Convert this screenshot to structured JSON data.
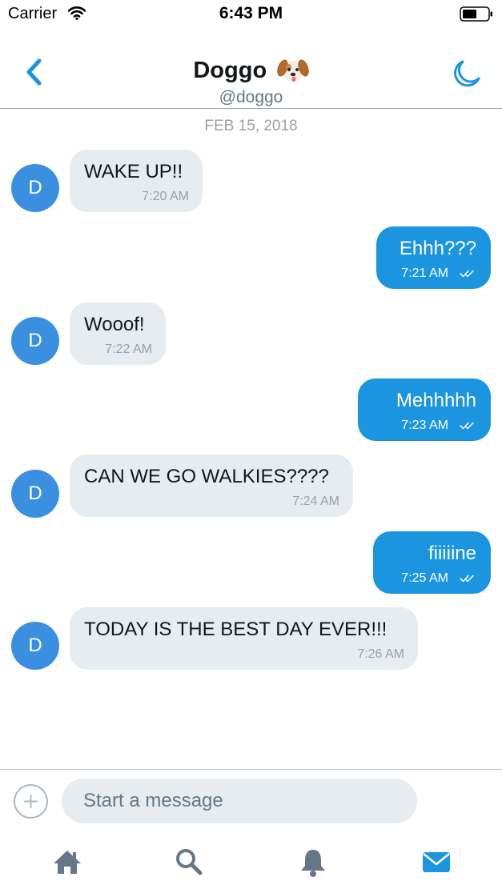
{
  "status_bar": {
    "carrier": "Carrier",
    "time": "6:43 PM",
    "icons": [
      "wifi-icon",
      "battery-icon"
    ]
  },
  "header": {
    "title": "Doggo",
    "title_emoji": "dog-face-icon",
    "handle": "@doggo",
    "icons": [
      "back-arrow-icon",
      "moon-icon"
    ],
    "accent_color": "#1b95e0"
  },
  "conversation": {
    "date": "FEB 15, 2018",
    "messages": [
      {
        "direction": "incoming",
        "avatar_letter": "D",
        "text": "WAKE UP!!",
        "time": "7:20 AM"
      },
      {
        "direction": "outgoing",
        "text": "Ehhh???",
        "time": "7:21 AM",
        "status_icon": "double-check-icon"
      },
      {
        "direction": "incoming",
        "avatar_letter": "D",
        "text": "Wooof!",
        "time": "7:22 AM"
      },
      {
        "direction": "outgoing",
        "text": "Mehhhhh",
        "time": "7:23 AM",
        "status_icon": "double-check-icon"
      },
      {
        "direction": "incoming",
        "avatar_letter": "D",
        "text": "CAN WE GO WALKIES????",
        "time": "7:24 AM"
      },
      {
        "direction": "outgoing",
        "text": "fiiiiine",
        "time": "7:25 AM",
        "status_icon": "double-check-icon"
      },
      {
        "direction": "incoming",
        "avatar_letter": "D",
        "text": "TODAY IS THE BEST DAY EVER!!!",
        "time": "7:26 AM"
      }
    ],
    "colors": {
      "incoming_bubble": "#e6ecf0",
      "outgoing_bubble": "#1b95e0",
      "avatar": "#3a8fe0"
    }
  },
  "composer": {
    "placeholder": "Start a message",
    "value": "",
    "add_icon": "plus-circle-icon"
  },
  "tab_bar": {
    "tabs": [
      {
        "icon": "home-icon",
        "active": false
      },
      {
        "icon": "search-icon",
        "active": false
      },
      {
        "icon": "bell-icon",
        "active": false
      },
      {
        "icon": "mail-icon",
        "active": true
      }
    ],
    "inactive_color": "#657786",
    "active_color": "#1b95e0"
  }
}
